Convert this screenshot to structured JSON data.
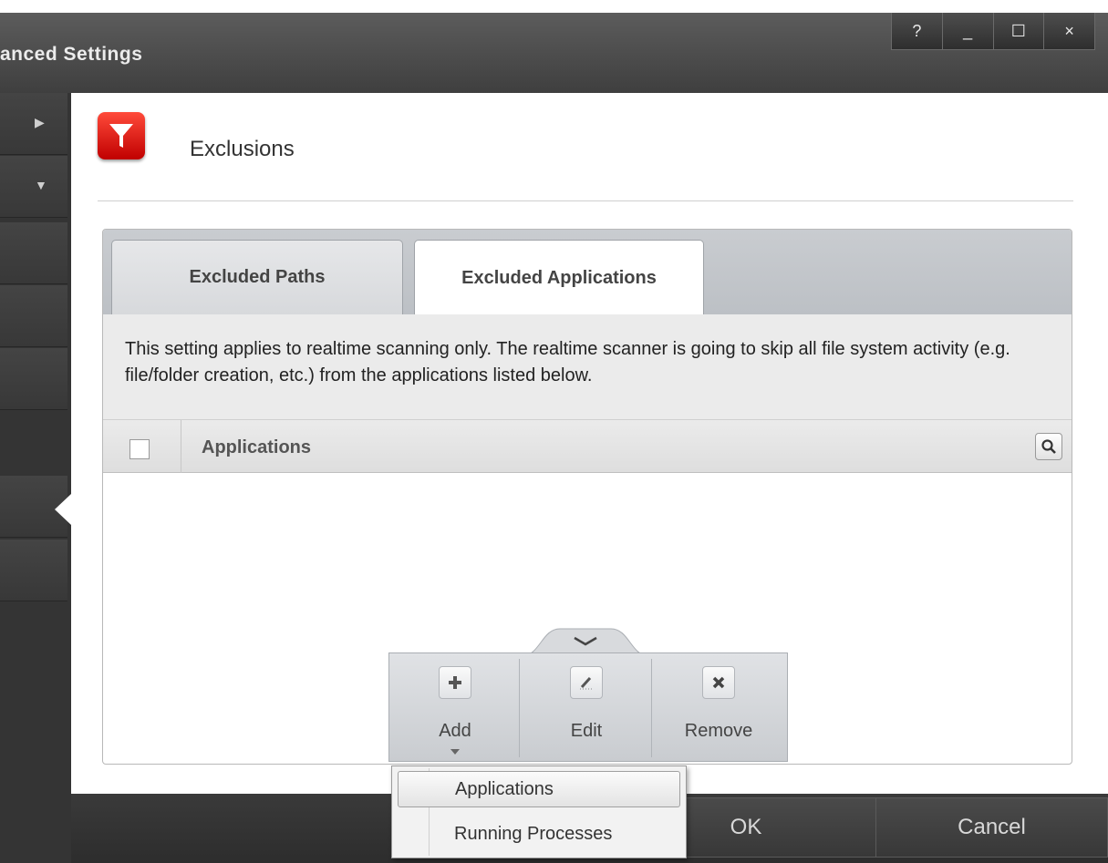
{
  "window": {
    "title": "anced Settings",
    "controls": [
      "?",
      "_",
      "☐",
      "×"
    ]
  },
  "header": {
    "title": "Exclusions",
    "icon": "filter-icon"
  },
  "tabs": [
    {
      "label": "Excluded Paths",
      "active": false
    },
    {
      "label": "Excluded Applications",
      "active": true
    }
  ],
  "description": "This setting applies to realtime scanning only. The realtime scanner is going to skip all file system activity (e.g. file/folder creation, etc.) from the applications listed below.",
  "table": {
    "column": "Applications",
    "rows": []
  },
  "toolbar": {
    "add_label": "Add",
    "edit_label": "Edit",
    "remove_label": "Remove"
  },
  "dropdown": {
    "items": [
      "Applications",
      "Running Processes"
    ],
    "highlighted": "Applications"
  },
  "footer": {
    "ok_label": "OK",
    "cancel_label": "Cancel"
  },
  "colors": {
    "header_icon": "#d81010",
    "window_frame": "#3e3e3e"
  }
}
